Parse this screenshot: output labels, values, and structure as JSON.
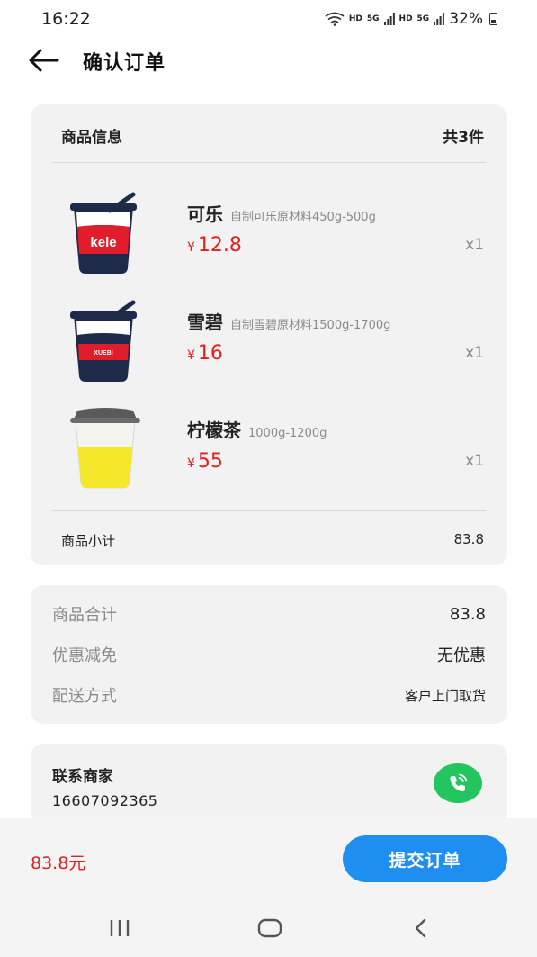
{
  "status_bar": {
    "time": "16:22",
    "hd1": "HD",
    "signal1": "5G",
    "hd2": "HD",
    "signal2": "5G",
    "battery": "32%"
  },
  "header": {
    "back_icon": "arrow-left-icon",
    "title": "确认订单"
  },
  "goods": {
    "title": "商品信息",
    "count": "共3件",
    "items": [
      {
        "name": "可乐",
        "spec": "自制可乐原材料450g-500g",
        "currency": "¥",
        "price": "12.8",
        "qty": "x1",
        "image": "cola-cup",
        "cup_label": "kele"
      },
      {
        "name": "雪碧",
        "spec": "自制雪碧原材料1500g-1700g",
        "currency": "¥",
        "price": "16",
        "qty": "x1",
        "image": "sprite-cup",
        "cup_label": "XUEBI"
      },
      {
        "name": "柠檬茶",
        "spec": "1000g-1200g",
        "currency": "¥",
        "price": "55",
        "qty": "x1",
        "image": "lemon-tea-cup"
      }
    ],
    "subtotal_label": "商品小计",
    "subtotal_value": "83.8"
  },
  "summary": {
    "rows": [
      {
        "label": "商品合计",
        "value": "83.8"
      },
      {
        "label": "优惠减免",
        "value": "无优惠"
      },
      {
        "label": "配送方式",
        "value": "客户上门取货"
      }
    ]
  },
  "contact": {
    "title": "联系商家",
    "phone": "16607092365",
    "call_icon": "phone-call-icon"
  },
  "bottom_bar": {
    "total": "83.8元",
    "submit_label": "提交订单"
  },
  "nav_bar": {
    "recents_icon": "recents-icon",
    "home_icon": "home-icon",
    "back_icon": "nav-back-icon"
  },
  "colors": {
    "accent": "#1f8ef1",
    "price_red": "#e02020",
    "call_green": "#22c55e",
    "card_bg": "#f2f2f2"
  }
}
